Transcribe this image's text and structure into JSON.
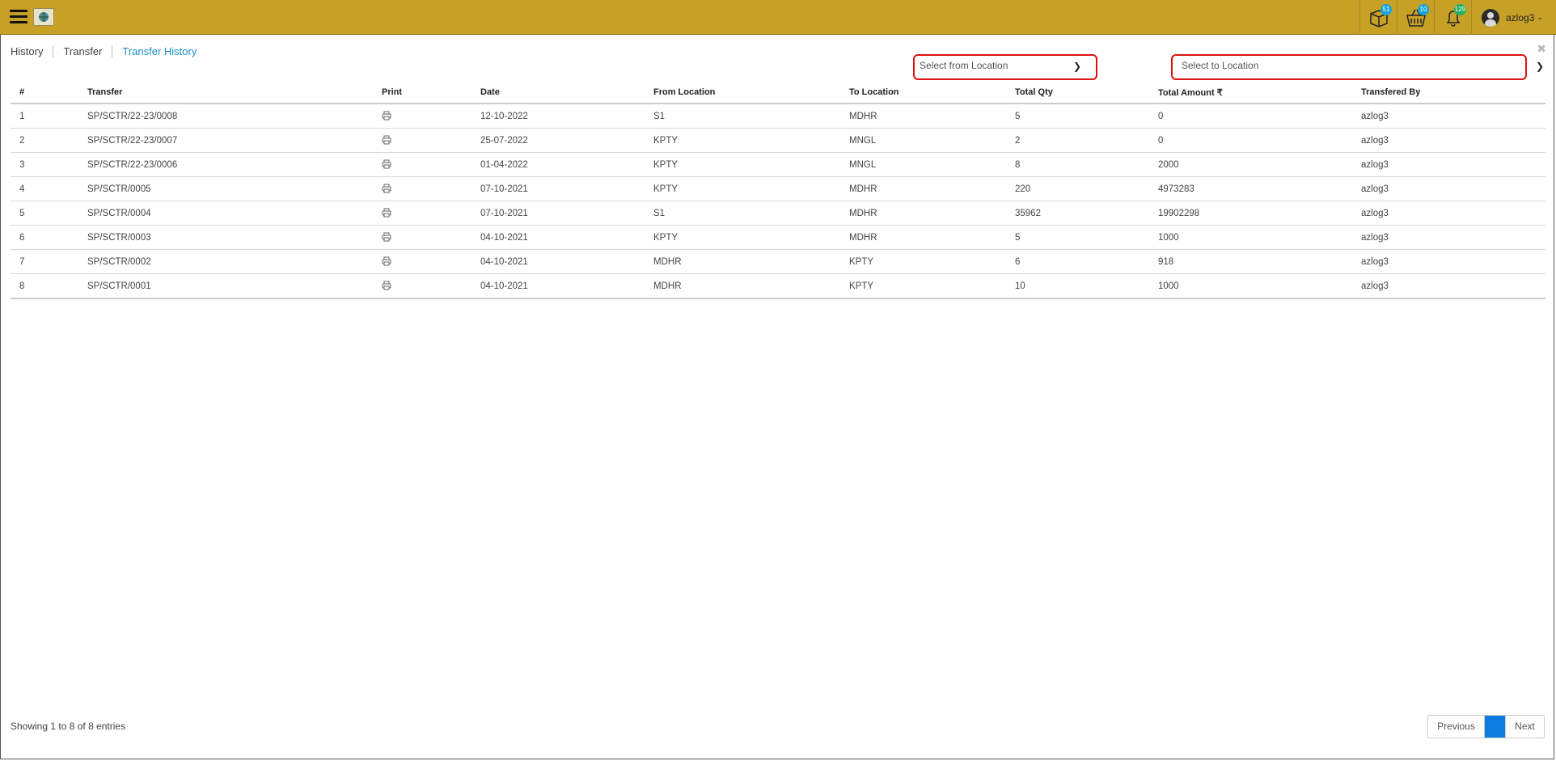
{
  "header": {
    "badges": {
      "orders": "51",
      "cart": "10",
      "notifications": "129"
    },
    "badge_colors": {
      "orders": "#1aa3d9",
      "cart": "#1aa3d9",
      "notifications": "#27ae60"
    },
    "username": "azlog3",
    "accent": "#c7a126"
  },
  "breadcrumb": {
    "items": [
      "History",
      "Transfer",
      "Transfer History"
    ]
  },
  "filters": {
    "from_placeholder": "Select from Location",
    "to_placeholder": "Select to Location"
  },
  "table": {
    "columns": [
      "#",
      "Transfer",
      "Print",
      "Date",
      "From Location",
      "To Location",
      "Total Qty",
      "Total Amount ₹",
      "Transfered By"
    ],
    "rows": [
      [
        "1",
        "SP/SCTR/22-23/0008",
        "",
        "12-10-2022",
        "S1",
        "MDHR",
        "5",
        "0",
        "azlog3"
      ],
      [
        "2",
        "SP/SCTR/22-23/0007",
        "",
        "25-07-2022",
        "KPTY",
        "MNGL",
        "2",
        "0",
        "azlog3"
      ],
      [
        "3",
        "SP/SCTR/22-23/0006",
        "",
        "01-04-2022",
        "KPTY",
        "MNGL",
        "8",
        "2000",
        "azlog3"
      ],
      [
        "4",
        "SP/SCTR/0005",
        "",
        "07-10-2021",
        "KPTY",
        "MDHR",
        "220",
        "4973283",
        "azlog3"
      ],
      [
        "5",
        "SP/SCTR/0004",
        "",
        "07-10-2021",
        "S1",
        "MDHR",
        "35962",
        "19902298",
        "azlog3"
      ],
      [
        "6",
        "SP/SCTR/0003",
        "",
        "04-10-2021",
        "KPTY",
        "MDHR",
        "5",
        "1000",
        "azlog3"
      ],
      [
        "7",
        "SP/SCTR/0002",
        "",
        "04-10-2021",
        "MDHR",
        "KPTY",
        "6",
        "918",
        "azlog3"
      ],
      [
        "8",
        "SP/SCTR/0001",
        "",
        "04-10-2021",
        "MDHR",
        "KPTY",
        "10",
        "1000",
        "azlog3"
      ]
    ]
  },
  "footer": {
    "info": "Showing 1 to 8 of 8 entries",
    "previous": "Previous",
    "page": "1",
    "next": "Next"
  }
}
